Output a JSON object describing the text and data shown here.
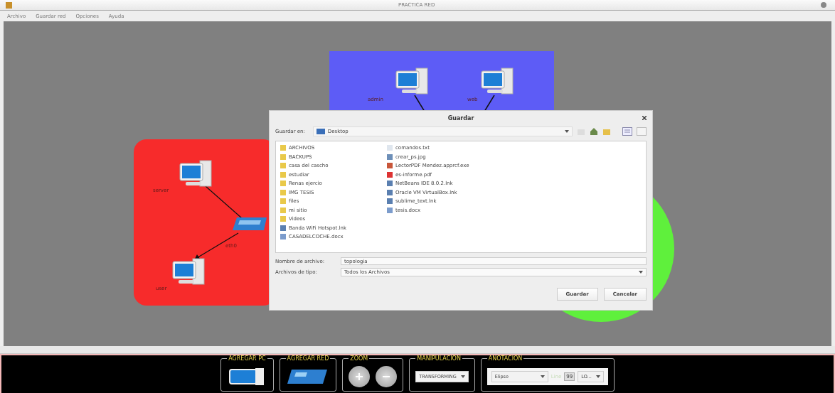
{
  "window": {
    "title": "PRACTICA RED"
  },
  "menu": [
    "Archivo",
    "Guardar red",
    "Opciones",
    "Ayuda"
  ],
  "canvas": {
    "zones": [
      {
        "kind": "rect",
        "color": "#5d5cf6"
      },
      {
        "kind": "rect",
        "color": "#f72b2b"
      },
      {
        "kind": "circle",
        "color": "#5ff03c"
      }
    ],
    "nodes": [
      {
        "kind": "pc",
        "label": "admin"
      },
      {
        "kind": "pc",
        "label": "web"
      },
      {
        "kind": "pc",
        "label": "server"
      },
      {
        "kind": "switch"
      },
      {
        "kind": "pc",
        "label": "user"
      }
    ],
    "link_label": "eth0"
  },
  "dialog": {
    "title": "Guardar",
    "look_in_label": "Guardar en:",
    "look_in": "Desktop",
    "files": [
      {
        "name": "ARCHIVOS",
        "kind": "folder"
      },
      {
        "name": "BACKUPS",
        "kind": "folder"
      },
      {
        "name": "casa del cascho",
        "kind": "folder"
      },
      {
        "name": "estudiar",
        "kind": "folder"
      },
      {
        "name": "Renas ejercio",
        "kind": "folder"
      },
      {
        "name": "IMG TESIS",
        "kind": "folder"
      },
      {
        "name": "files",
        "kind": "folder"
      },
      {
        "name": "mi sitio",
        "kind": "folder"
      },
      {
        "name": "Videos",
        "kind": "folder"
      },
      {
        "name": "Banda WiFi Hotspot.lnk",
        "kind": "link"
      },
      {
        "name": "CASADELCOCHE.docx",
        "kind": "doc"
      },
      {
        "name": "comandos.txt",
        "kind": "text"
      },
      {
        "name": "crear_ps.jpg",
        "kind": "image"
      },
      {
        "name": "LectorPDF Mendez.apprcf.exe",
        "kind": "exe"
      },
      {
        "name": "es-informe.pdf",
        "kind": "pdf"
      },
      {
        "name": "NetBeans IDE 8.0.2.lnk",
        "kind": "link"
      },
      {
        "name": "Oracle VM VirtualBox.lnk",
        "kind": "link"
      },
      {
        "name": "sublime_text.lnk",
        "kind": "link"
      },
      {
        "name": "tesis.docx",
        "kind": "doc"
      }
    ],
    "file_name_label": "Nombre de archivo:",
    "file_name": "topologia",
    "file_type_label": "Archivos de tipo:",
    "file_type": "Todos los Archivos",
    "buttons": [
      "Guardar",
      "Cancelar"
    ]
  },
  "toolbar": [
    {
      "kind": "pc",
      "title": "AGREGAR PC"
    },
    {
      "kind": "network",
      "title": "AGREGAR RED"
    },
    {
      "kind": "zoom",
      "title": "ZOOM"
    },
    {
      "kind": "select",
      "title": "MANIPULACIÓN",
      "value": "TRANSFORMING"
    },
    {
      "kind": "annotation",
      "title": "ANOTACIÓN",
      "shape": "Elipse",
      "text": "Line",
      "size": "99",
      "font": "LO..."
    }
  ]
}
